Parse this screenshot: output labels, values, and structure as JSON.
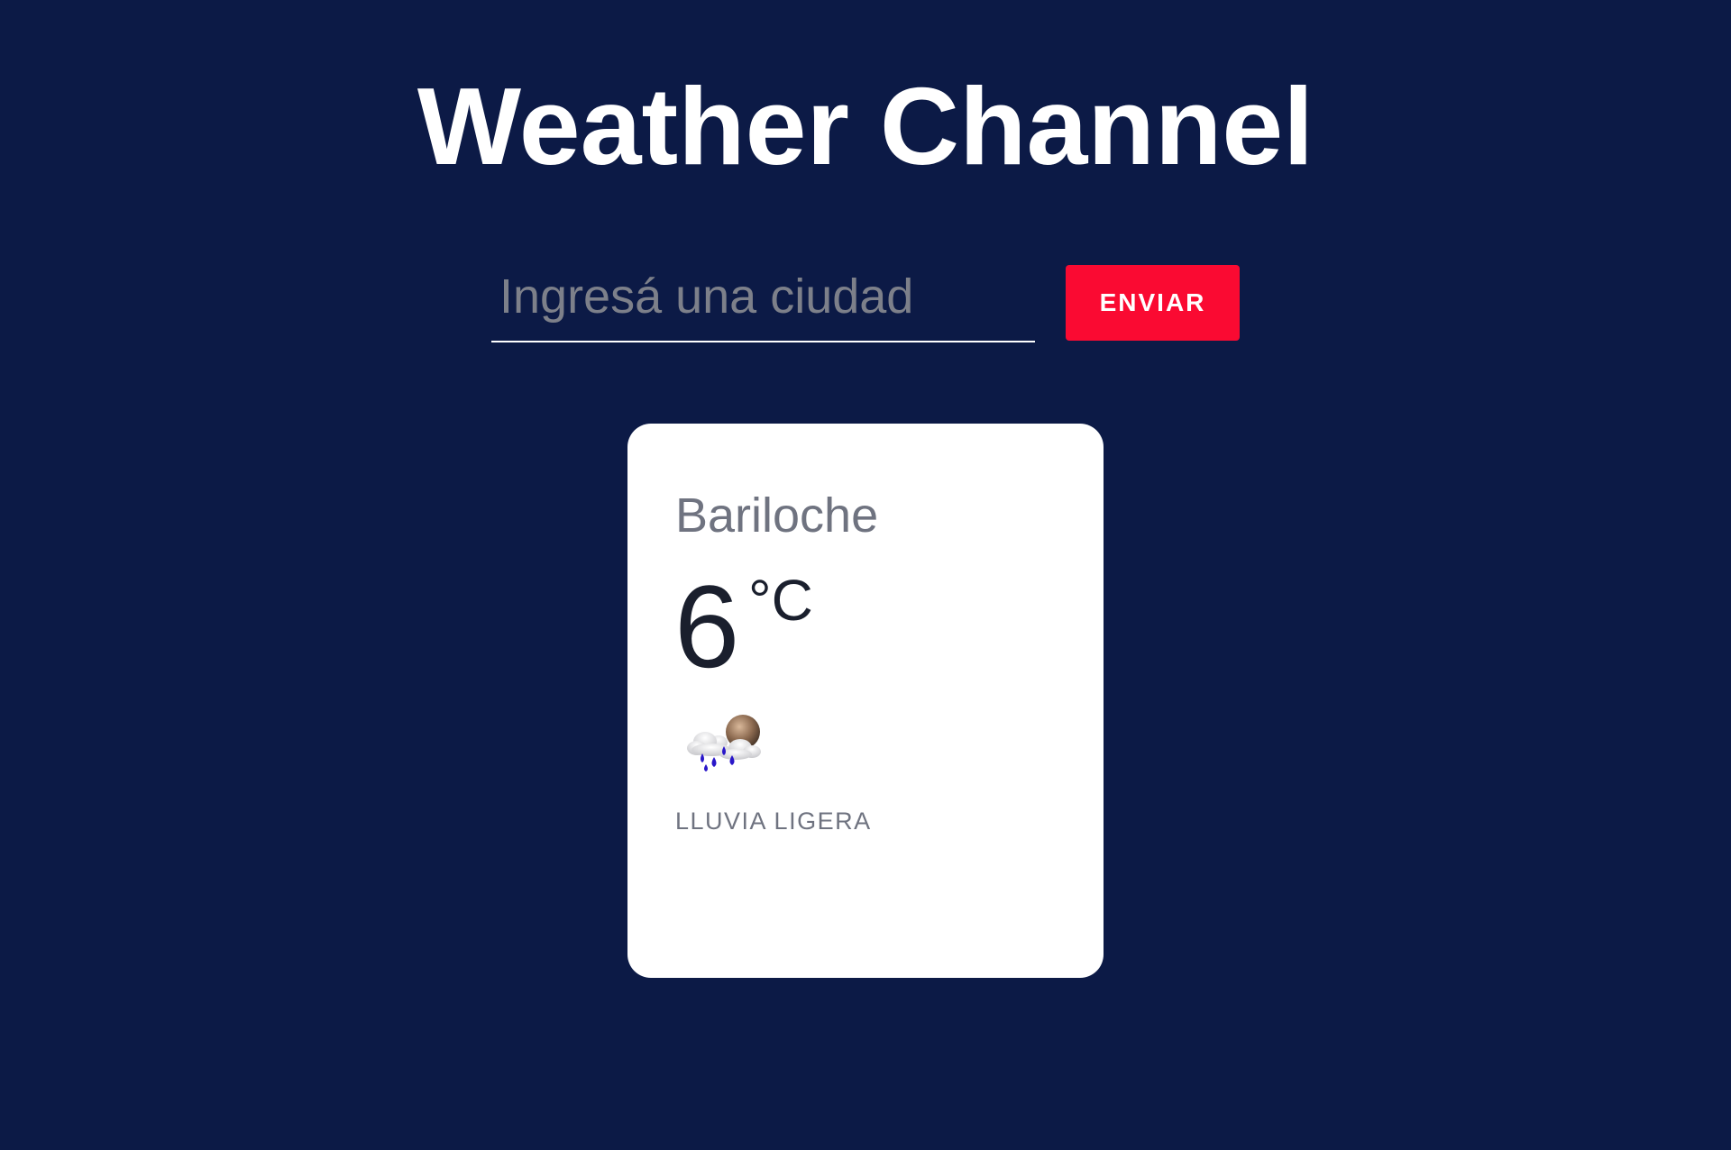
{
  "header": {
    "title": "Weather Channel"
  },
  "search": {
    "placeholder": "Ingresá una ciudad",
    "value": "",
    "button_label": "ENVIAR"
  },
  "weather_card": {
    "city": "Bariloche",
    "temperature": "6",
    "unit": "°C",
    "icon": "light-rain-cloud-moon-icon",
    "description": "LLUVIA LIGERA"
  },
  "colors": {
    "background": "#0c1a46",
    "accent_button": "#fa0a32",
    "card_background": "#ffffff",
    "muted_text": "#6f7380",
    "primary_text": "#1a1f2d"
  }
}
